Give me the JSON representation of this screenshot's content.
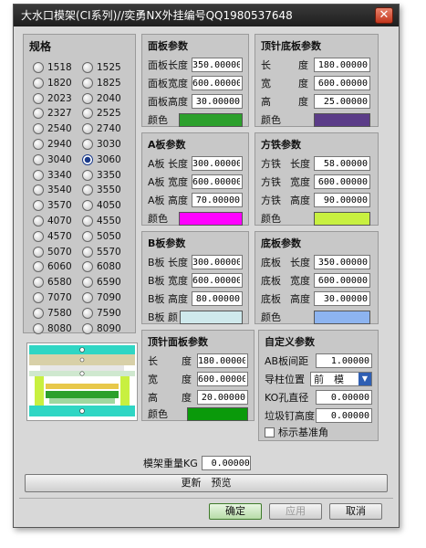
{
  "window": {
    "title": "大水口模架(CI系列)//奕勇NX外挂编号QQ1980537648"
  },
  "spec": {
    "title": "规格",
    "options": [
      "1518",
      "1525",
      "1820",
      "1825",
      "2023",
      "2040",
      "2327",
      "2525",
      "2540",
      "2740",
      "2940",
      "3030",
      "3040",
      "3060",
      "3340",
      "3350",
      "3540",
      "3550",
      "3570",
      "4050",
      "4070",
      "4550",
      "4570",
      "5050",
      "5070",
      "5570",
      "6060",
      "6080",
      "6580",
      "6590",
      "7070",
      "7090",
      "7580",
      "7590",
      "8080",
      "8090"
    ],
    "selected": "3060"
  },
  "panel_face": {
    "title": "面板参数",
    "rows": [
      {
        "label": "面板长度",
        "value": "350.00000"
      },
      {
        "label": "面板宽度",
        "value": "600.00000"
      },
      {
        "label": "面板高度",
        "value": "30.00000"
      }
    ],
    "color_label": "颜色",
    "color": "#2ca02c"
  },
  "panel_ejector_bottom": {
    "title": "顶针底板参数",
    "rows": [
      {
        "label": "长",
        "label2": "度",
        "value": "180.00000"
      },
      {
        "label": "宽",
        "label2": "度",
        "value": "600.00000"
      },
      {
        "label": "高",
        "label2": "度",
        "value": "25.00000"
      }
    ],
    "color_label": "颜色",
    "color": "#5b3c88"
  },
  "panel_a": {
    "title": "A板参数",
    "rows": [
      {
        "label": "A板 长度",
        "value": "300.00000"
      },
      {
        "label": "A板 宽度",
        "value": "600.00000"
      },
      {
        "label": "A板 高度",
        "value": "70.00000"
      }
    ],
    "color_label": "颜色",
    "color": "#ff00ff"
  },
  "panel_square": {
    "title": "方铁参数",
    "rows": [
      {
        "label": "方铁",
        "label2": "长度",
        "value": "58.00000"
      },
      {
        "label": "方铁",
        "label2": "宽度",
        "value": "600.00000"
      },
      {
        "label": "方铁",
        "label2": "高度",
        "value": "90.00000"
      }
    ],
    "color_label": "颜色",
    "color": "#c8f040"
  },
  "panel_b": {
    "title": "B板参数",
    "rows": [
      {
        "label": "B板 长度",
        "value": "300.00000"
      },
      {
        "label": "B板 宽度",
        "value": "600.00000"
      },
      {
        "label": "B板 高度",
        "value": "80.00000"
      }
    ],
    "color_label": "B板 颜",
    "color": "#cfe9ec"
  },
  "panel_bottom": {
    "title": "底板参数",
    "rows": [
      {
        "label": "底板",
        "label2": "长度",
        "value": "350.00000"
      },
      {
        "label": "底板",
        "label2": "宽度",
        "value": "600.00000"
      },
      {
        "label": "底板",
        "label2": "高度",
        "value": "30.00000"
      }
    ],
    "color_label": "颜色",
    "color": "#8db4f0"
  },
  "panel_ejector_face": {
    "title": "顶针面板参数",
    "rows": [
      {
        "label": "长",
        "label2": "度",
        "value": "180.00000"
      },
      {
        "label": "宽",
        "label2": "度",
        "value": "600.00000"
      },
      {
        "label": "高",
        "label2": "度",
        "value": "20.00000"
      }
    ],
    "color_label": "颜色",
    "color": "#0a9a0a"
  },
  "panel_custom": {
    "title": "自定义参数",
    "ab_gap_label": "AB板间距",
    "ab_gap": "1.00000",
    "guide_label": "导柱位置",
    "guide_value": "前　模",
    "ko_label": "KO孔直径",
    "ko_value": "0.00000",
    "stop_label": "垃圾钉高度",
    "stop_value": "0.00000",
    "checkbox_label": "标示基准角"
  },
  "weight": {
    "label": "模架重量KG",
    "value": "0.00000"
  },
  "buttons": {
    "update": "更新　预览",
    "ok": "确定",
    "apply": "应用",
    "cancel": "取消"
  }
}
